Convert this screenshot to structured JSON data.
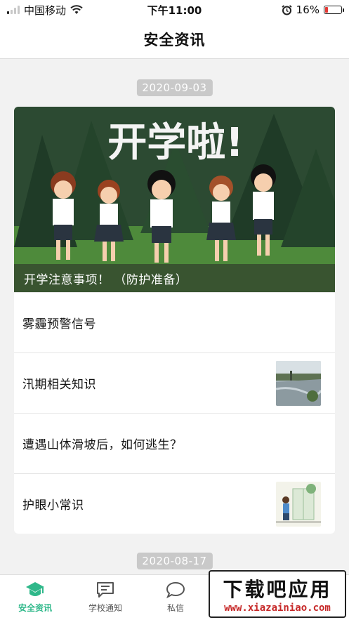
{
  "status_bar": {
    "carrier": "中国移动",
    "time": "下午11:00",
    "battery_percent": "16%",
    "battery_level": 0.16,
    "signal_bars_on": 1,
    "icons": [
      "signal-icon",
      "wifi-icon",
      "alarm-icon",
      "battery-icon"
    ]
  },
  "nav": {
    "title": "安全资讯"
  },
  "feed": {
    "groups": [
      {
        "date": "2020-09-03",
        "banner": {
          "headline_art": "开学啦!",
          "caption": "开学注意事项！ （防护准备）"
        },
        "items": [
          {
            "title": "雾霾预警信号",
            "has_thumbnail": false
          },
          {
            "title": "汛期相关知识",
            "has_thumbnail": true,
            "thumbnail": "flood-image"
          },
          {
            "title": "遭遇山体滑坡后，如何逃生？",
            "has_thumbnail": false
          },
          {
            "title": "护眼小常识",
            "has_thumbnail": true,
            "thumbnail": "eye-care-image"
          }
        ]
      },
      {
        "date": "2020-08-17"
      }
    ]
  },
  "tab_bar": {
    "active_color": "#2fb88a",
    "tabs": [
      {
        "label": "安全资讯",
        "icon": "graduation-cap-icon",
        "active": true
      },
      {
        "label": "学校通知",
        "icon": "message-square-icon",
        "active": false
      },
      {
        "label": "私信",
        "icon": "chat-bubble-icon",
        "active": false
      }
    ]
  },
  "watermark": {
    "main": "下载吧应用",
    "sub": "www.xiazainiao.com"
  }
}
